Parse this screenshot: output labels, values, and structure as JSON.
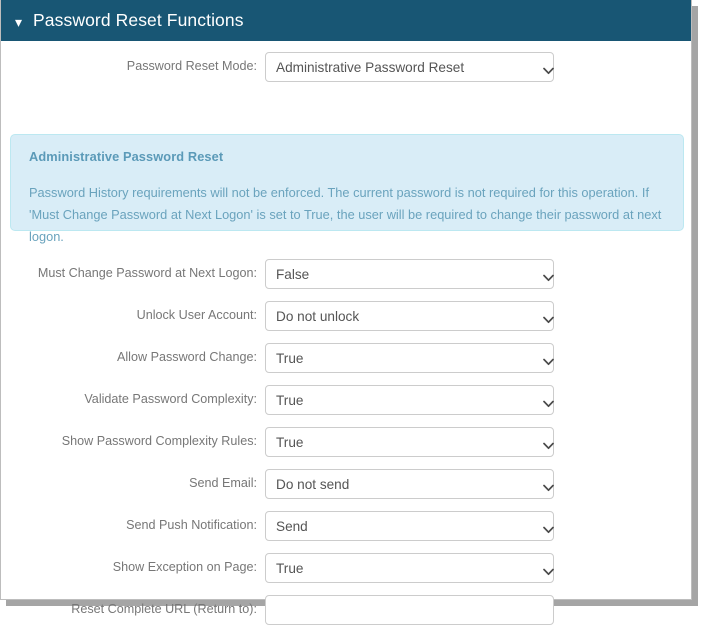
{
  "panel": {
    "title": "Password Reset Functions",
    "collapse_icon": "chevron-down-icon"
  },
  "mode_row": {
    "label": "Password Reset Mode:",
    "value": "Administrative Password Reset"
  },
  "alert": {
    "title": "Administrative Password Reset",
    "text": "Password History requirements will not be enforced. The current password is not required for this operation. If 'Must Change Password at Next Logon' is set to True, the user will be required to change their password at next logon."
  },
  "fields": [
    {
      "label": "Must Change Password at Next Logon:",
      "value": "False",
      "type": "select"
    },
    {
      "label": "Unlock User Account:",
      "value": "Do not unlock",
      "type": "select"
    },
    {
      "label": "Allow Password Change:",
      "value": "True",
      "type": "select"
    },
    {
      "label": "Validate Password Complexity:",
      "value": "True",
      "type": "select"
    },
    {
      "label": "Show Password Complexity Rules:",
      "value": "True",
      "type": "select"
    },
    {
      "label": "Send Email:",
      "value": "Do not send",
      "type": "select"
    },
    {
      "label": "Send Push Notification:",
      "value": "Send",
      "type": "select"
    },
    {
      "label": "Show Exception on Page:",
      "value": "True",
      "type": "select"
    },
    {
      "label": "Reset Complete URL (Return to):",
      "value": "",
      "type": "text"
    }
  ],
  "colors": {
    "header_bg": "#185674",
    "alert_bg": "#d9edf7",
    "alert_border": "#bce8f1",
    "alert_text": "#6aa3bd",
    "label_text": "#777777",
    "value_text": "#555555",
    "control_border": "#cccccc"
  }
}
